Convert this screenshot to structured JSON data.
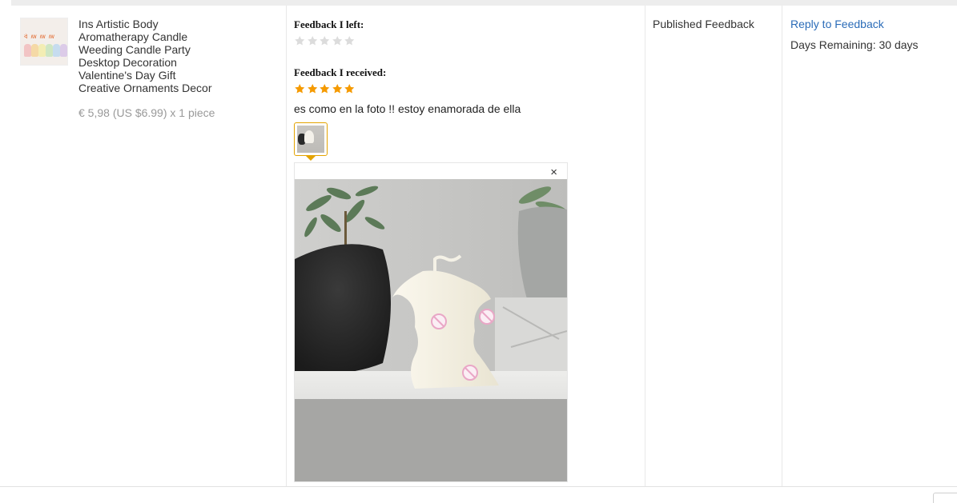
{
  "product": {
    "title_lines": [
      "Ins Artistic Body",
      "Aromatherapy Candle",
      "Weeding Candle Party",
      "Desktop Decoration",
      "Valentine's Day Gift",
      "Creative Ornaments Decor"
    ],
    "price": "€ 5,98 (US $6.99) x 1 piece",
    "thumbnail_icon": "candle-product-photo"
  },
  "feedback": {
    "left_label": "Feedback I left:",
    "left_rating": 0,
    "received_label": "Feedback I received:",
    "received_rating": 5,
    "max_rating": 5,
    "comment": "es como en la foto !! estoy enamorada de ella",
    "photo_icon": "customer-photo",
    "close_symbol": "×"
  },
  "status": {
    "text": "Published Feedback"
  },
  "actions": {
    "reply_label": "Reply to Feedback",
    "days_remaining": "Days Remaining: 30 days"
  },
  "colors": {
    "star_filled": "#f59a00",
    "star_empty": "#dcdcdc",
    "link": "#2b6cb8",
    "thumb_border": "#e3a300",
    "price": "#999999"
  }
}
